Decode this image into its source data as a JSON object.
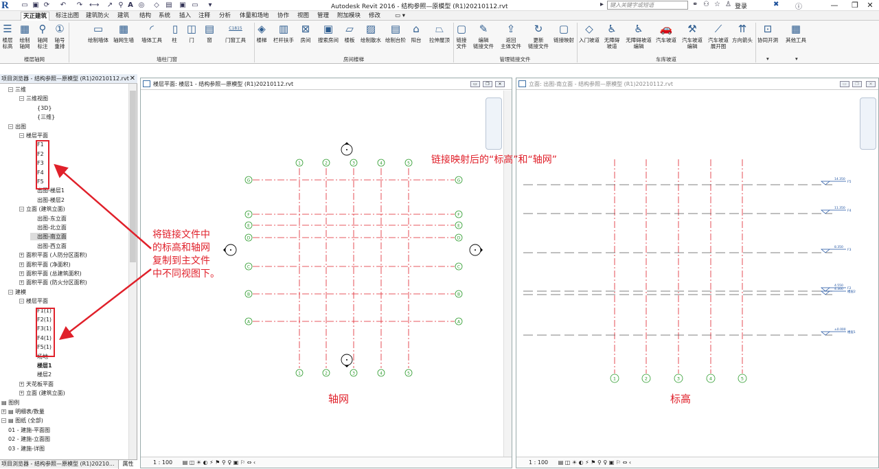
{
  "titlebar": {
    "title": "Autodesk Revit 2016 -     结构参照—原模型 (R1)20210112.rvt",
    "search_placeholder": "键入关键字或短语",
    "login": "登录",
    "min": "—",
    "restore": "❐",
    "close": "✕"
  },
  "tabs": [
    "天正建筑",
    "标注出图",
    "建筑防火",
    "建筑",
    "结构",
    "系统",
    "插入",
    "注释",
    "分析",
    "体量和场地",
    "协作",
    "视图",
    "管理",
    "附加模块",
    "修改",
    "▭ ▾"
  ],
  "ribbon": {
    "buttons": [
      {
        "label": "楼层\n标高",
        "icon": "☰"
      },
      {
        "label": "绘制\n轴网",
        "icon": "▦"
      },
      {
        "label": "轴网\n标注",
        "icon": "⚲"
      },
      {
        "label": "轴号\n重排",
        "icon": "①"
      },
      {
        "label": "绘制墙体",
        "icon": "▭"
      },
      {
        "label": "轴网生墙",
        "icon": "▦"
      },
      {
        "label": "墙体工具",
        "icon": "◜"
      },
      {
        "label": "柱",
        "icon": "▯"
      },
      {
        "label": "门",
        "icon": "◫"
      },
      {
        "label": "窗",
        "icon": "▤"
      },
      {
        "label": "门窗工具",
        "icon": "C1815"
      },
      {
        "label": "楼梯",
        "icon": "◈"
      },
      {
        "label": "栏杆扶手",
        "icon": "▥"
      },
      {
        "label": "房间",
        "icon": "⊠"
      },
      {
        "label": "搜索房间",
        "icon": "▣"
      },
      {
        "label": "楼板",
        "icon": "▱"
      },
      {
        "label": "绘制散水",
        "icon": "▨"
      },
      {
        "label": "绘制台阶",
        "icon": "▤"
      },
      {
        "label": "阳台",
        "icon": "⌂"
      },
      {
        "label": "拉伸屋顶",
        "icon": "⏢"
      },
      {
        "label": "链接\n文件",
        "icon": "▢"
      },
      {
        "label": "编辑\n链接文件",
        "icon": "✎"
      },
      {
        "label": "返回\n主体文件",
        "icon": "⇪"
      },
      {
        "label": "更新\n链接文件",
        "icon": "↻"
      },
      {
        "label": "链接映射",
        "icon": "▢"
      },
      {
        "label": "入门坡道",
        "icon": "◇"
      },
      {
        "label": "无障碍\n坡道",
        "icon": "♿"
      },
      {
        "label": "无障碍坡道\n编辑",
        "icon": "♿"
      },
      {
        "label": "汽车坡道",
        "icon": "🚗"
      },
      {
        "label": "汽车坡道\n编辑",
        "icon": "⚒"
      },
      {
        "label": "汽车坡道\n展开图",
        "icon": "⟋"
      },
      {
        "label": "方向箭头",
        "icon": "⇈"
      },
      {
        "label": "协同开洞",
        "icon": "⊡"
      },
      {
        "label": "其他工具",
        "icon": "▦"
      }
    ],
    "groups": [
      "楼层轴网",
      "墙柱门窗",
      "房间楼梯",
      "管理链接文件",
      "车库坡道"
    ],
    "arrows": [
      "▾",
      "▾"
    ]
  },
  "browser": {
    "title": "项目浏览器 - 结构参照—原模型 (R1)20210112.rvt",
    "close": "✕",
    "items": [
      {
        "t": "三维",
        "lvl": 1,
        "tg": "−"
      },
      {
        "t": "三维视图",
        "lvl": 2,
        "tg": "−"
      },
      {
        "t": "{3D}",
        "lvl": 3
      },
      {
        "t": "{三维}",
        "lvl": 3
      },
      {
        "t": "出图",
        "lvl": 1,
        "tg": "−"
      },
      {
        "t": "楼层平面",
        "lvl": 2,
        "tg": "−"
      },
      {
        "t": "F1",
        "lvl": 3
      },
      {
        "t": "F2",
        "lvl": 3
      },
      {
        "t": "F3",
        "lvl": 3
      },
      {
        "t": "F4",
        "lvl": 3
      },
      {
        "t": "F5",
        "lvl": 3
      },
      {
        "t": "出图-楼层1",
        "lvl": 3
      },
      {
        "t": "出图-楼层2",
        "lvl": 3
      },
      {
        "t": "立面 (建筑立面)",
        "lvl": 2,
        "tg": "−"
      },
      {
        "t": "出图-东立面",
        "lvl": 3
      },
      {
        "t": "出图-北立面",
        "lvl": 3
      },
      {
        "t": "出图-南立面",
        "lvl": 3,
        "sel": true
      },
      {
        "t": "出图-西立面",
        "lvl": 3
      },
      {
        "t": "面积平面 (人防分区面积)",
        "lvl": 2,
        "tg": "+"
      },
      {
        "t": "面积平面 (净面积)",
        "lvl": 2,
        "tg": "+"
      },
      {
        "t": "面积平面 (总建筑面积)",
        "lvl": 2,
        "tg": "+"
      },
      {
        "t": "面积平面 (防火分区面积)",
        "lvl": 2,
        "tg": "+"
      },
      {
        "t": "建模",
        "lvl": 1,
        "tg": "−"
      },
      {
        "t": "楼层平面",
        "lvl": 2,
        "tg": "−"
      },
      {
        "t": "F1(1)",
        "lvl": 3
      },
      {
        "t": "F2(1)",
        "lvl": 3
      },
      {
        "t": "F3(1)",
        "lvl": 3
      },
      {
        "t": "F4(1)",
        "lvl": 3
      },
      {
        "t": "F5(1)",
        "lvl": 3
      },
      {
        "t": "场地",
        "lvl": 3
      },
      {
        "t": "楼层1",
        "lvl": 3,
        "bold": true
      },
      {
        "t": "楼层2",
        "lvl": 3
      },
      {
        "t": "天花板平面",
        "lvl": 2,
        "tg": "+"
      },
      {
        "t": "立面 (建筑立面)",
        "lvl": 2,
        "tg": "+"
      },
      {
        "t": "图例",
        "lvl": 0,
        "icon": true
      },
      {
        "t": "明细表/数量",
        "lvl": 0,
        "icon": true,
        "tg": "+"
      },
      {
        "t": "图纸 (全部)",
        "lvl": 0,
        "icon": true,
        "tg": "−"
      },
      {
        "t": "01 - 建施-平面图",
        "lvl": 1
      },
      {
        "t": "02 - 建施-立面图",
        "lvl": 1
      },
      {
        "t": "03 - 建施-详图",
        "lvl": 1
      }
    ],
    "footer": "项目浏览器 - 结构参照—原模型 (R1)20210...",
    "props_tab": "属性"
  },
  "view1": {
    "title": "楼层平面: 楼层1 - 结构参照—原模型 (R1)20210112.rvt",
    "scale": "1 : 100",
    "caption": "轴网",
    "v_grids": [
      "1",
      "2",
      "3",
      "4",
      "5"
    ],
    "h_grids": [
      "G",
      "F",
      "E",
      "D",
      "C",
      "B",
      "A"
    ]
  },
  "view2": {
    "title": "立面: 出图-南立面 - 结构参照—原模型 (R1)20210112.rvt",
    "scale": "1 : 100",
    "caption": "标高",
    "grids": [
      "1",
      "2",
      "3",
      "4",
      "5"
    ],
    "levels": [
      {
        "elev": "14.350",
        "name": "F5"
      },
      {
        "elev": "11.350",
        "name": "F4"
      },
      {
        "elev": "8.350",
        "name": "F3"
      },
      {
        "elev": "4.550",
        "name": "F2"
      },
      {
        "elev": "4.300",
        "name": "楼层2"
      },
      {
        "elev": "±0.000",
        "name": "楼层1"
      }
    ]
  },
  "annotations": {
    "left_note": [
      "将链接文件中",
      "的标高和轴网",
      "复制到主文件",
      "中不同视图下。"
    ],
    "right_note": "链接映射后的“标高”和“轴网”"
  }
}
